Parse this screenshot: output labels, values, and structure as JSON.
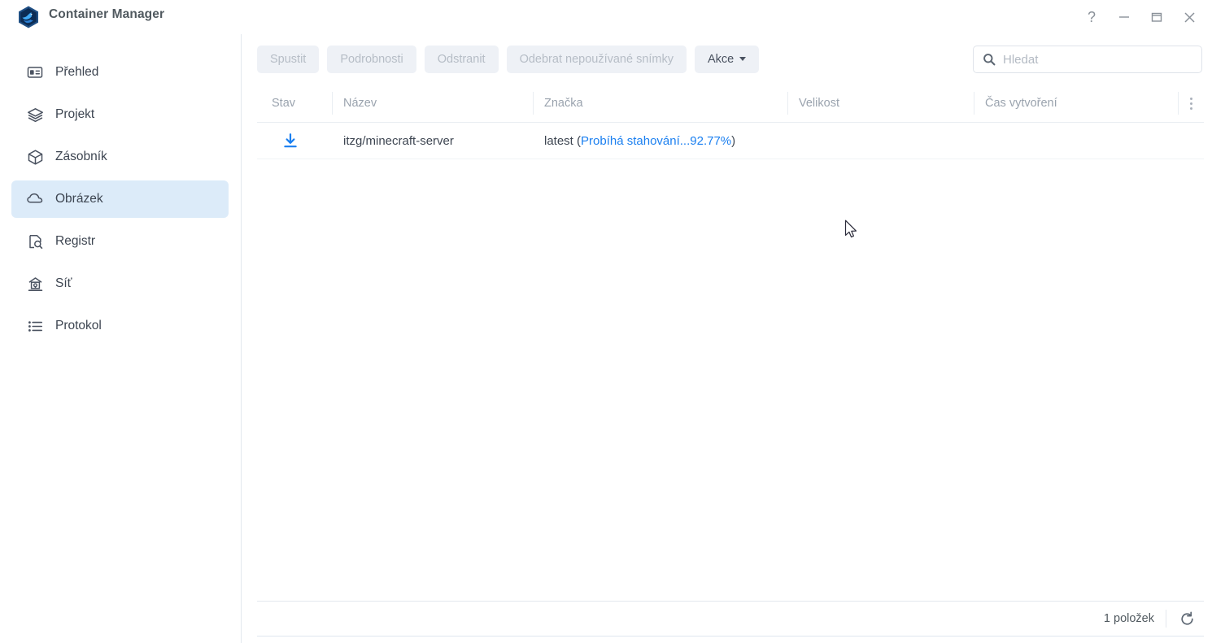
{
  "window": {
    "title": "Container Manager",
    "app_icon": "container-manager-hexagon-icon",
    "controls": [
      {
        "name": "help-button",
        "glyph": "?"
      },
      {
        "name": "minimize-button",
        "glyph": "—"
      },
      {
        "name": "maximize-button",
        "glyph": "□"
      },
      {
        "name": "close-button",
        "glyph": "✕"
      }
    ]
  },
  "sidebar": {
    "items": [
      {
        "label": "Přehled",
        "icon": "dashboard-card-icon",
        "active": false
      },
      {
        "label": "Projekt",
        "icon": "layers-icon",
        "active": false
      },
      {
        "label": "Zásobník",
        "icon": "cube-icon",
        "active": false
      },
      {
        "label": "Obrázek",
        "icon": "cloud-icon",
        "active": true
      },
      {
        "label": "Registr",
        "icon": "document-search-icon",
        "active": false
      },
      {
        "label": "Síť",
        "icon": "network-node-icon",
        "active": false
      },
      {
        "label": "Protokol",
        "icon": "list-icon",
        "active": false
      }
    ]
  },
  "toolbar": {
    "buttons": [
      {
        "label": "Spustit",
        "enabled": false
      },
      {
        "label": "Podrobnosti",
        "enabled": false
      },
      {
        "label": "Odstranit",
        "enabled": false
      },
      {
        "label": "Odebrat nepoužívané snímky",
        "enabled": false
      },
      {
        "label": "Akce",
        "enabled": true,
        "has_caret": true
      }
    ]
  },
  "search": {
    "placeholder": "Hledat",
    "value": "",
    "icon": "search-icon"
  },
  "table": {
    "columns": [
      {
        "key": "stav",
        "label": "Stav"
      },
      {
        "key": "nazev",
        "label": "Název"
      },
      {
        "key": "znacka",
        "label": "Značka"
      },
      {
        "key": "velikost",
        "label": "Velikost"
      },
      {
        "key": "cas",
        "label": "Čas vytvoření"
      }
    ],
    "column_options_icon": "kebab-menu-icon",
    "rows": [
      {
        "status_icon": "download-icon",
        "nazev": "itzg/minecraft-server",
        "tag_prefix": "latest (",
        "tag_status": "Probíhá stahování...92.77%",
        "tag_suffix": ")",
        "velikost": "",
        "cas": ""
      }
    ]
  },
  "footer": {
    "count_label": "1 položek",
    "refresh_icon": "refresh-icon"
  },
  "colors": {
    "accent": "#1a7ff0",
    "active_nav_bg": "#dcebf9",
    "text": "#3d4551",
    "muted": "#9aa3ae",
    "border": "#e3e8ee"
  }
}
